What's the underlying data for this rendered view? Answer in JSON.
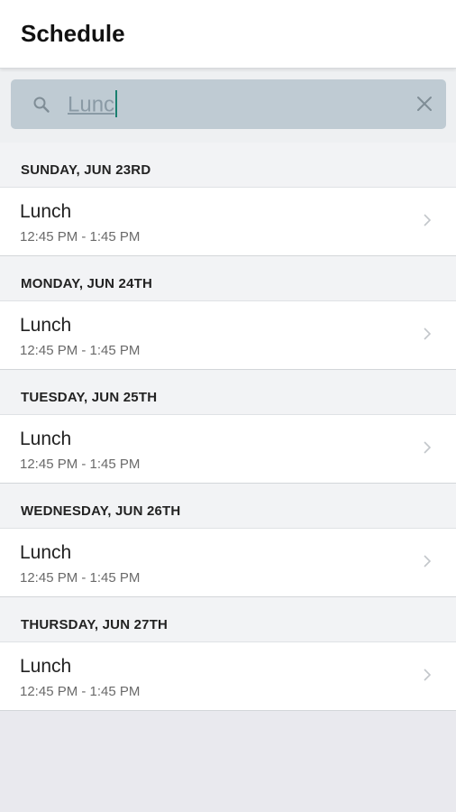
{
  "header": {
    "title": "Schedule"
  },
  "search": {
    "value": "Lunc",
    "icon": "search-icon",
    "clear_icon": "close-icon"
  },
  "colors": {
    "accent_caret": "#1a7f6f",
    "search_bg": "#bfcbd3",
    "page_bg": "#e9e9ee"
  },
  "sections": [
    {
      "day": "SUNDAY, JUN 23RD",
      "items": [
        {
          "name": "Lunch",
          "time": "12:45 PM - 1:45 PM"
        }
      ]
    },
    {
      "day": "MONDAY, JUN 24TH",
      "items": [
        {
          "name": "Lunch",
          "time": "12:45 PM - 1:45 PM"
        }
      ]
    },
    {
      "day": "TUESDAY, JUN 25TH",
      "items": [
        {
          "name": "Lunch",
          "time": "12:45 PM - 1:45 PM"
        }
      ]
    },
    {
      "day": "WEDNESDAY, JUN 26TH",
      "items": [
        {
          "name": "Lunch",
          "time": "12:45 PM - 1:45 PM"
        }
      ]
    },
    {
      "day": "THURSDAY, JUN 27TH",
      "items": [
        {
          "name": "Lunch",
          "time": "12:45 PM - 1:45 PM"
        }
      ]
    }
  ]
}
